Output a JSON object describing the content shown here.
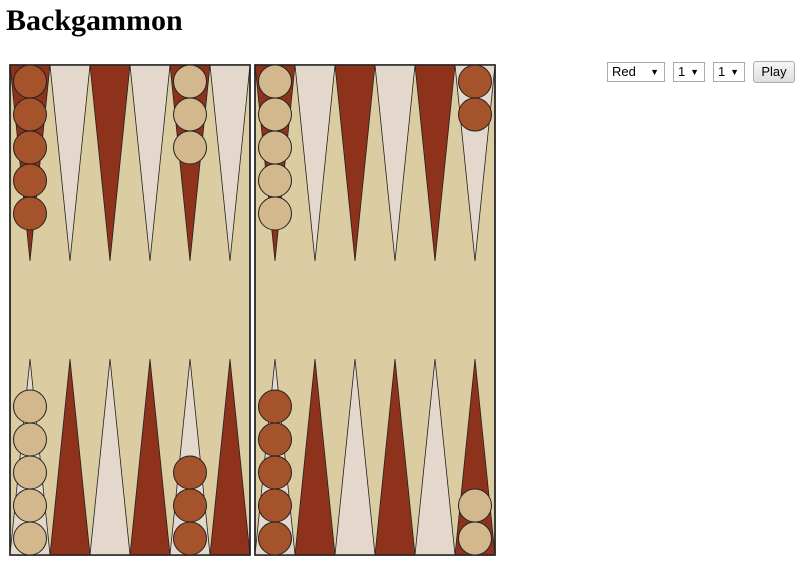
{
  "title": "Backgammon",
  "controls": {
    "color_select": "Red",
    "die1_select": "1",
    "die2_select": "1",
    "play_label": "Play"
  },
  "colors": {
    "board": "#dbcca2",
    "dark_point": "#8e321c",
    "light_point": "#e4d8cc",
    "red_checker": "#a4532a",
    "tan_checker": "#d2b88c",
    "outline": "#222222"
  },
  "board_state": {
    "top_points": [
      {
        "color": "red",
        "count": 5
      },
      null,
      null,
      null,
      {
        "color": "tan",
        "count": 3
      },
      null,
      {
        "color": "tan",
        "count": 5
      },
      null,
      null,
      null,
      null,
      {
        "color": "red",
        "count": 2
      }
    ],
    "bottom_points": [
      {
        "color": "tan",
        "count": 5
      },
      null,
      null,
      null,
      {
        "color": "red",
        "count": 3
      },
      null,
      {
        "color": "red",
        "count": 5
      },
      null,
      null,
      null,
      null,
      {
        "color": "tan",
        "count": 2
      }
    ]
  }
}
